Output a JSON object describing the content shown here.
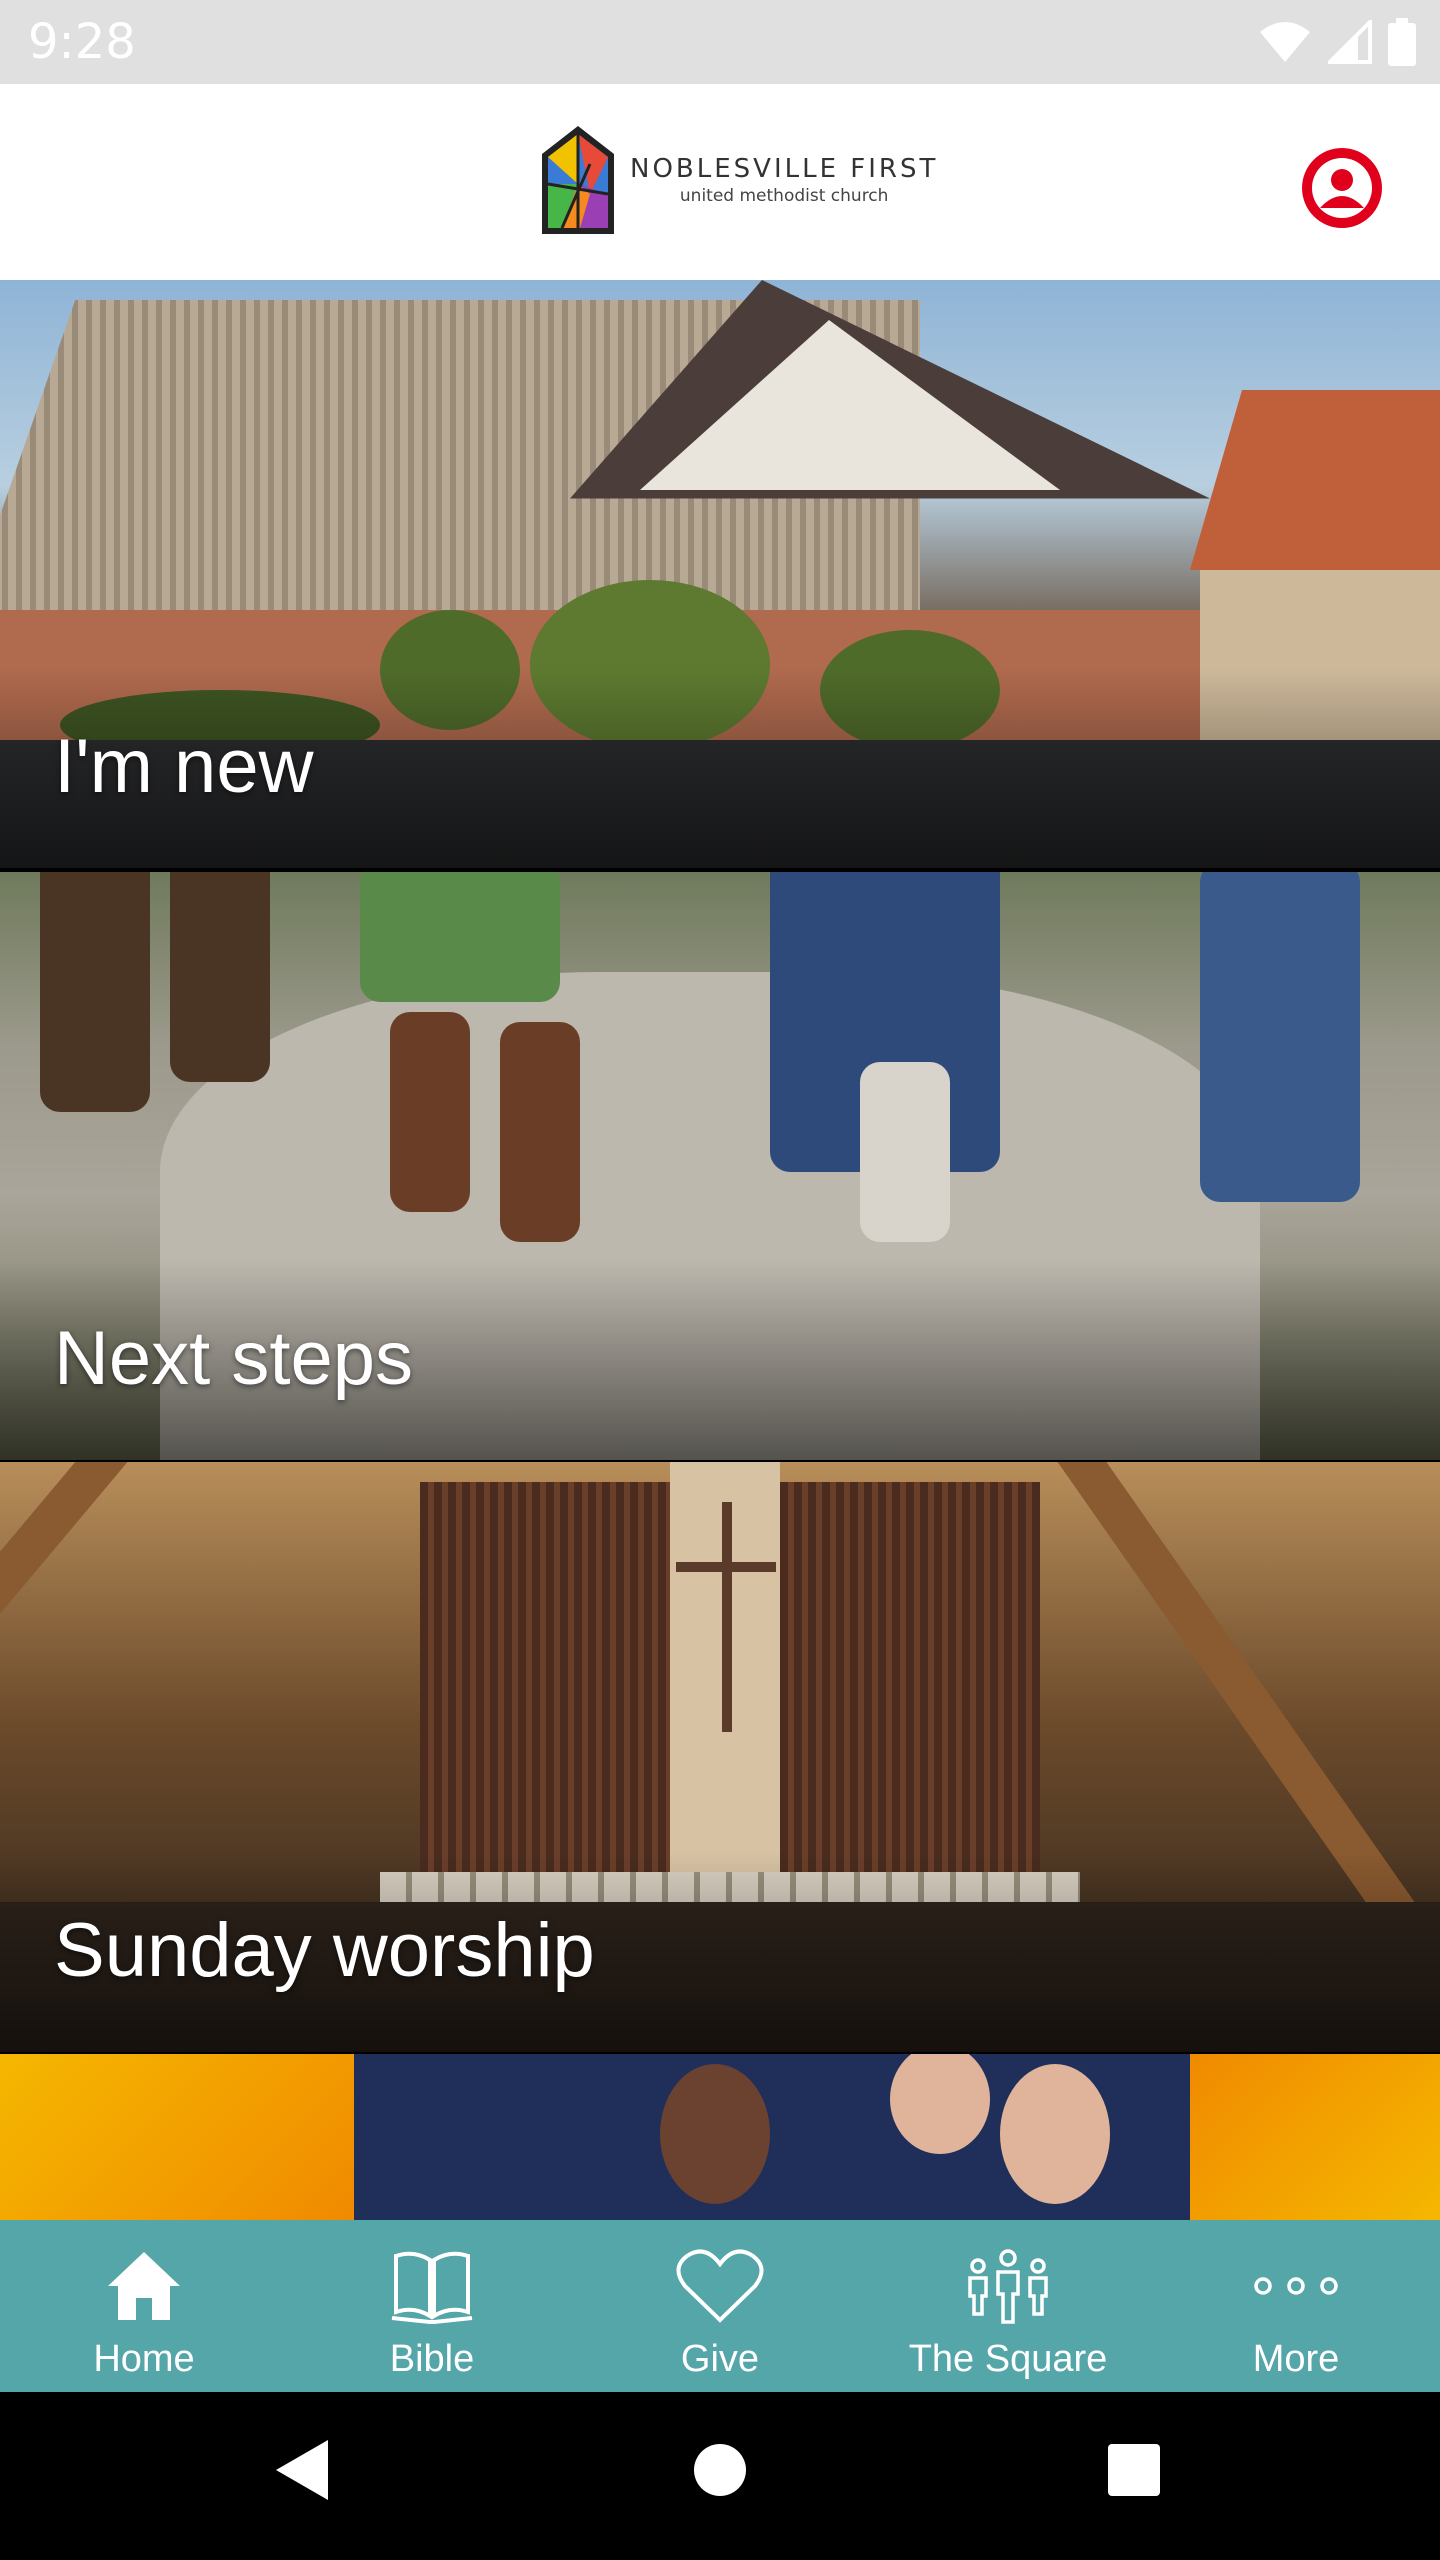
{
  "status_bar": {
    "time": "9:28"
  },
  "header": {
    "logo_name": "NOBLESVILLE FIRST",
    "logo_subtitle": "united methodist church"
  },
  "tiles": [
    {
      "label": "I'm new"
    },
    {
      "label": "Next steps"
    },
    {
      "label": "Sunday worship"
    }
  ],
  "bottom_nav": {
    "items": [
      {
        "label": "Home",
        "icon": "home-icon"
      },
      {
        "label": "Bible",
        "icon": "book-icon"
      },
      {
        "label": "Give",
        "icon": "heart-icon"
      },
      {
        "label": "The Square",
        "icon": "people-icon"
      },
      {
        "label": "More",
        "icon": "more-icon"
      }
    ]
  },
  "colors": {
    "nav_background": "#55a6a9",
    "profile_accent": "#e0001b",
    "status_bar": "#e0e0e0"
  }
}
